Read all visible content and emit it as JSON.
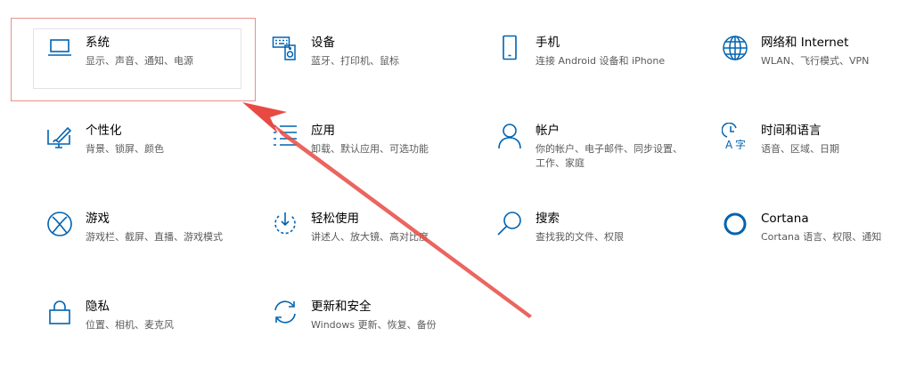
{
  "accent_color": "#0063b1",
  "annotation_color": "#e84a43",
  "tiles": [
    {
      "title": "系统",
      "desc": "显示、声音、通知、电源",
      "icon": "laptop-icon"
    },
    {
      "title": "设备",
      "desc": "蓝牙、打印机、鼠标",
      "icon": "keyboard-speaker-icon"
    },
    {
      "title": "手机",
      "desc": "连接 Android 设备和 iPhone",
      "icon": "phone-icon"
    },
    {
      "title": "网络和 Internet",
      "desc": "WLAN、飞行模式、VPN",
      "icon": "globe-icon"
    },
    {
      "title": "个性化",
      "desc": "背景、锁屏、颜色",
      "icon": "paint-icon"
    },
    {
      "title": "应用",
      "desc": "卸载、默认应用、可选功能",
      "icon": "apps-list-icon"
    },
    {
      "title": "帐户",
      "desc": "你的帐户、电子邮件、同步设置、工作、家庭",
      "icon": "person-icon"
    },
    {
      "title": "时间和语言",
      "desc": "语音、区域、日期",
      "icon": "time-language-icon"
    },
    {
      "title": "游戏",
      "desc": "游戏栏、截屏、直播、游戏模式",
      "icon": "xbox-icon"
    },
    {
      "title": "轻松使用",
      "desc": "讲述人、放大镜、高对比度",
      "icon": "ease-of-access-icon"
    },
    {
      "title": "搜索",
      "desc": "查找我的文件、权限",
      "icon": "search-icon"
    },
    {
      "title": "Cortana",
      "desc": "Cortana 语言、权限、通知",
      "icon": "cortana-icon"
    },
    {
      "title": "隐私",
      "desc": "位置、相机、麦克风",
      "icon": "lock-icon"
    },
    {
      "title": "更新和安全",
      "desc": "Windows 更新、恢复、备份",
      "icon": "sync-icon"
    }
  ]
}
